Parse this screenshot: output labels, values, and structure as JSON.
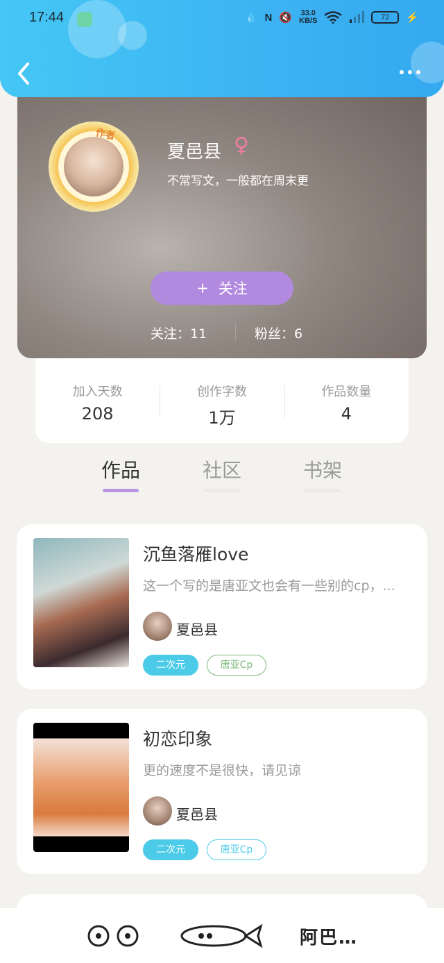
{
  "status_bar": {
    "time": "17:44",
    "net_speed_value": "33.0",
    "net_speed_unit": "KB/S",
    "battery": "72"
  },
  "header": {
    "back_icon": "chevron-left-icon",
    "more_icon": "more-dots-icon"
  },
  "profile": {
    "name": "夏邑县",
    "gender_symbol": "♀",
    "avatar_badge": "作者",
    "bio": "不常写文，一般都在周末更",
    "follow_button": "关注",
    "follow_plus": "+",
    "following_text": "关注：11",
    "followers_text": "粉丝：6"
  },
  "stats": [
    {
      "label": "加入天数",
      "value": "208"
    },
    {
      "label": "创作字数",
      "value": "1万"
    },
    {
      "label": "作品数量",
      "value": "4"
    }
  ],
  "tabs": [
    {
      "label": "作品",
      "active": true
    },
    {
      "label": "社区",
      "active": false
    },
    {
      "label": "书架",
      "active": false
    }
  ],
  "works": [
    {
      "title": "沉鱼落雁love",
      "description": "这一个写的是唐亚文也会有一些别的cp，...",
      "author": "夏邑县",
      "tags": [
        "二次元",
        "唐亚Cp"
      ],
      "tag_b_color": "#7ab87a"
    },
    {
      "title": "初恋印象",
      "description": "更的速度不是很快，请见谅",
      "author": "夏邑县",
      "tags": [
        "二次元",
        "唐亚Cp"
      ],
      "tag_b_color": "#4ccbe8"
    }
  ],
  "bottom_bar": {
    "left_icon": "flower-icon",
    "center_icon": "fish-icon",
    "right_text": "阿巴…"
  },
  "colors": {
    "header": "#3cb3f2",
    "follow_button": "#b18ae0",
    "active_tab_underline": "#b996e0",
    "tag_primary": "#4ccbe8"
  }
}
